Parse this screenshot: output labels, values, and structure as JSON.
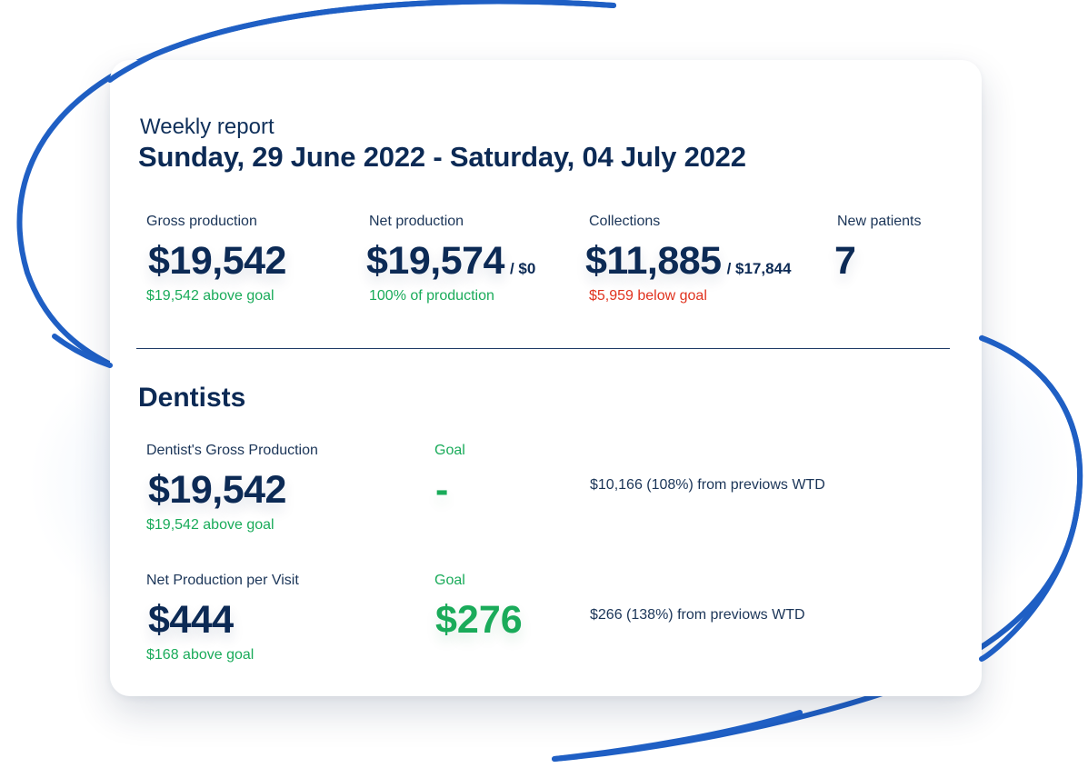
{
  "report": {
    "label": "Weekly report",
    "date_range": "Sunday, 29 June 2022 - Saturday, 04 July 2022"
  },
  "summary": {
    "gross": {
      "label": "Gross production",
      "value": "$19,542",
      "note": "$19,542 above goal"
    },
    "net": {
      "label": "Net production",
      "value": "$19,574",
      "denominator": "/ $0",
      "note": "100% of production"
    },
    "collections": {
      "label": "Collections",
      "value": "$11,885",
      "denominator": "/ $17,844",
      "note": "$5,959 below goal"
    },
    "new_patients": {
      "label": "New patients",
      "value": "7"
    }
  },
  "dentists": {
    "title": "Dentists",
    "rows": [
      {
        "label": "Dentist's Gross Production",
        "value": "$19,542",
        "note": "$19,542 above goal",
        "goal_label": "Goal",
        "goal_value": "-",
        "compare": "$10,166 (108%) from previows WTD"
      },
      {
        "label": "Net Production per Visit",
        "value": "$444",
        "note": "$168 above goal",
        "goal_label": "Goal",
        "goal_value": "$276",
        "compare": "$266 (138%) from previows WTD"
      }
    ]
  },
  "colors": {
    "navy": "#0c2a55",
    "green": "#1aab5a",
    "red": "#e0321e",
    "swirl": "#1f5fc4"
  }
}
